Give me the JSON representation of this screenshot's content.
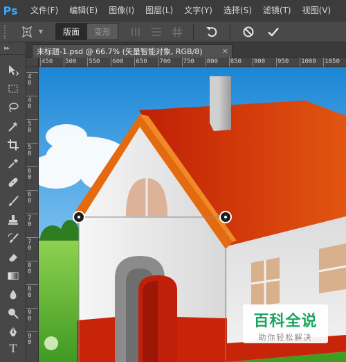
{
  "app": {
    "logo": "Ps"
  },
  "menu": [
    {
      "label": "文件(F)"
    },
    {
      "label": "编辑(E)"
    },
    {
      "label": "图像(I)"
    },
    {
      "label": "图层(L)"
    },
    {
      "label": "文字(Y)"
    },
    {
      "label": "选择(S)"
    },
    {
      "label": "滤镜(T)"
    },
    {
      "label": "视图(V)"
    }
  ],
  "options_bar": {
    "tool_icon": "puppet-warp-icon",
    "mode_buttons": [
      {
        "label": "版面",
        "active": true
      },
      {
        "label": "变形",
        "active": false
      }
    ],
    "split_icons": [
      "split-vertical-icon",
      "split-horizontal-icon",
      "split-grid-icon"
    ],
    "actions": [
      "undo-icon",
      "cancel-icon",
      "commit-icon"
    ]
  },
  "toolbar": {
    "collapse_glyph": "▸▸",
    "tools": [
      "move-tool-icon",
      "marquee-tool-icon",
      "lasso-tool-icon",
      "magic-wand-tool-icon",
      "crop-tool-icon",
      "eyedropper-tool-icon",
      "healing-brush-tool-icon",
      "brush-tool-icon",
      "clone-stamp-tool-icon",
      "history-brush-tool-icon",
      "eraser-tool-icon",
      "gradient-tool-icon",
      "blur-tool-icon",
      "dodge-tool-icon",
      "pen-tool-icon",
      "type-tool-icon"
    ],
    "type_tool_glyph": "T"
  },
  "document": {
    "tab_title": "未标题-1.psd @ 66.7% (矢量智能对象, RGB/8)",
    "close_glyph": "×",
    "zoom_percent": 66.7
  },
  "ruler": {
    "top_labels": [
      "450",
      "500",
      "550",
      "600",
      "650",
      "700",
      "750",
      "800",
      "850",
      "900",
      "950",
      "1000",
      "1050"
    ],
    "left_labels": [
      "4",
      "4",
      "5",
      "5",
      "6",
      "6",
      "7",
      "7",
      "8",
      "8",
      "9",
      "9"
    ]
  },
  "watermark": {
    "title": "百科全说",
    "subtitle": "助你轻松解决"
  },
  "colors": {
    "roof_red": "#cc2a08",
    "roof_orange": "#e86a12",
    "wall_white": "#eeeeee",
    "sky_blue": "#1e8fd8",
    "grass_green": "#5aa82c",
    "watermark_green": "#1aa55e"
  }
}
